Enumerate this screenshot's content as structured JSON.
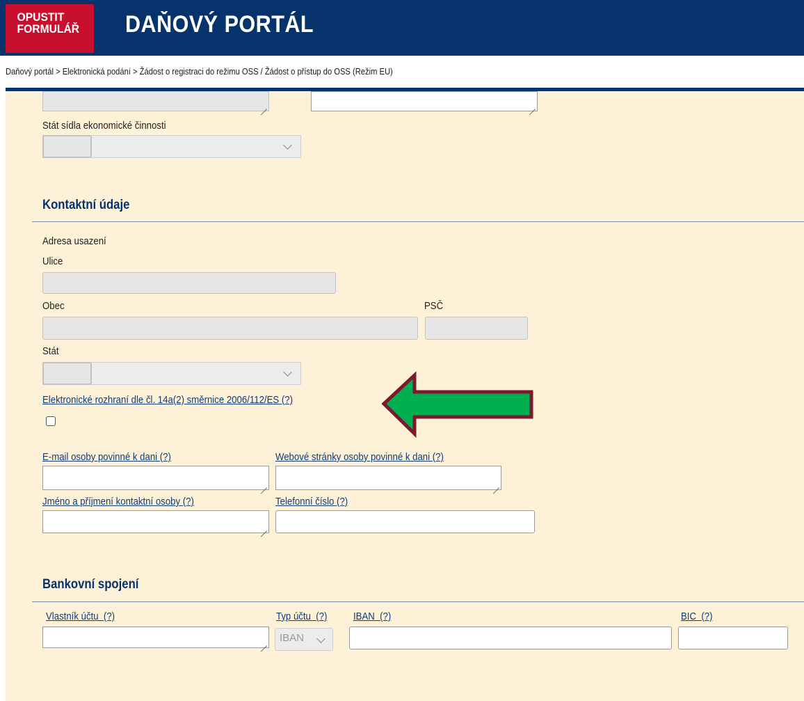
{
  "header": {
    "exit_line1": "OPUSTIT",
    "exit_line2": "FORMULÁŘ",
    "title": "DAŇOVÝ PORTÁL"
  },
  "breadcrumb": "Daňový portál > Elektronická podání > Žádost o registraci do režimu OSS / Žádost o přístup do OSS (Režim EU)",
  "economic_activity": {
    "country_label": "Stát sídla ekonomické činnosti"
  },
  "contact": {
    "section_title": "Kontaktní údaje",
    "address_heading": "Adresa usazení",
    "street_label": "Ulice",
    "city_label": "Obec",
    "zip_label": "PSČ",
    "country_label": "Stát",
    "electronic_interface_label": "Elektronické rozhraní dle čl. 14a(2) směrnice 2006/112/ES",
    "email_label": "E-mail osoby povinné k dani",
    "web_label": "Webové stránky osoby povinné k dani",
    "contact_person_label": "Jméno a příjmení kontaktní osoby",
    "phone_label": "Telefonní číslo",
    "help": "(?)"
  },
  "bank": {
    "section_title": "Bankovní spojení",
    "owner_label": "Vlastník účtu",
    "account_type_label": "Typ účtu",
    "iban_label": "IBAN",
    "bic_label": "BIC",
    "help": "(?)",
    "account_type_value": "IBAN"
  },
  "annotation": {
    "arrow_fill": "#00b050",
    "arrow_stroke": "#7b1a2e"
  }
}
